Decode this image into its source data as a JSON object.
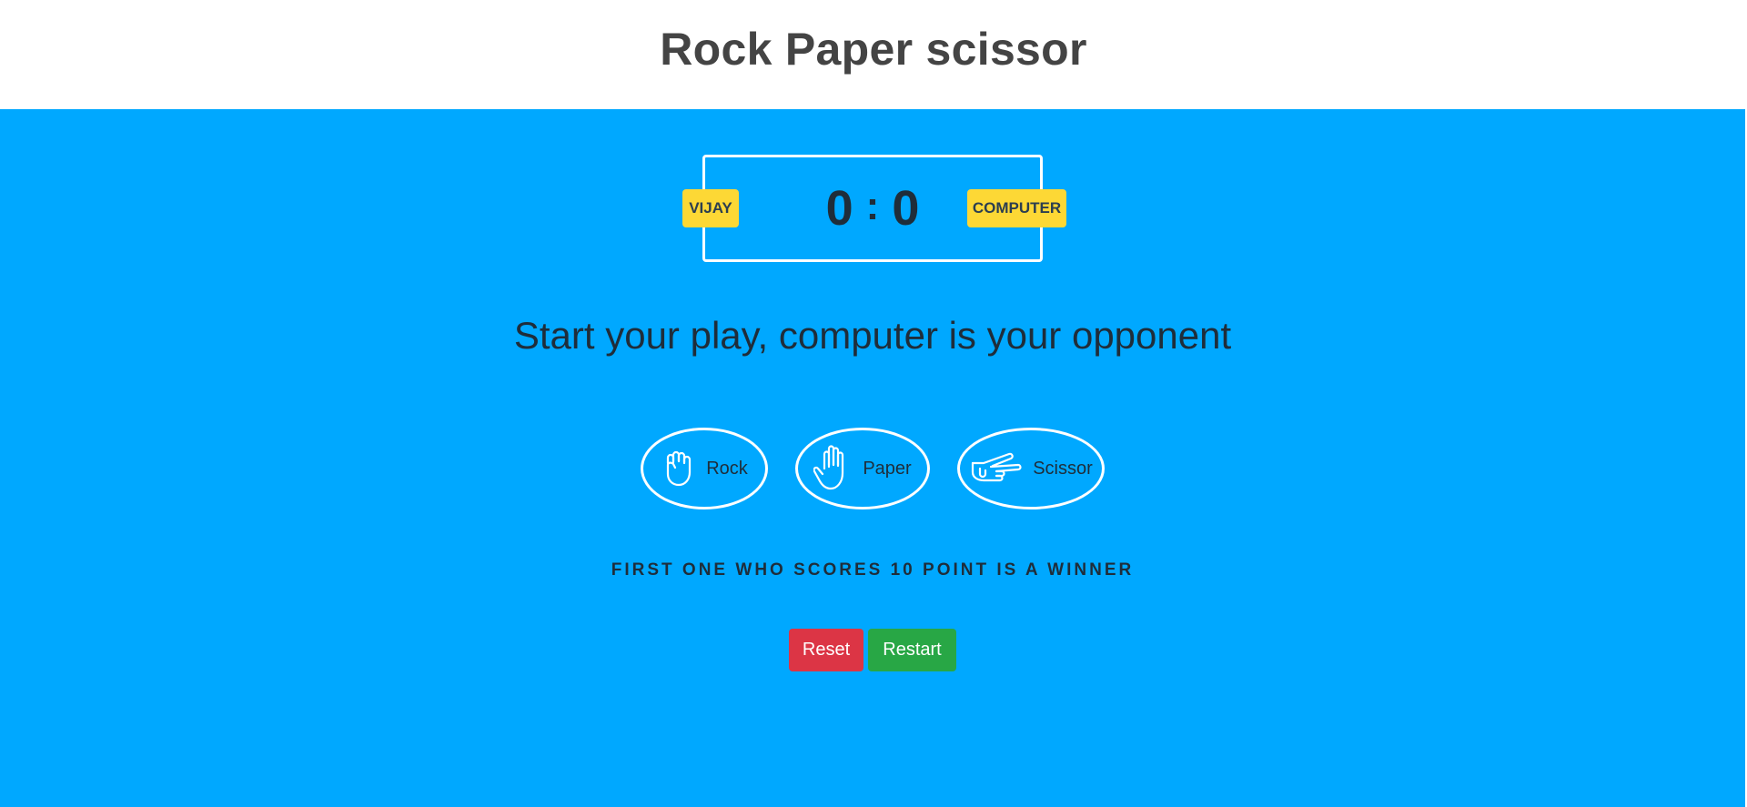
{
  "header": {
    "title": "Rock Paper scissor"
  },
  "scoreboard": {
    "user_label": "VIJAY",
    "computer_label": "COMPUTER",
    "user_score": "0",
    "separator": ":",
    "computer_score": "0"
  },
  "message": "Start your play, computer is your opponent",
  "choices": [
    {
      "label": "Rock",
      "icon": "fist-icon"
    },
    {
      "label": "Paper",
      "icon": "open-hand-icon"
    },
    {
      "label": "Scissor",
      "icon": "peace-hand-icon"
    }
  ],
  "rule_text": "FIRST ONE WHO SCORES 10 POINT IS A WINNER",
  "buttons": {
    "reset_label": "Reset",
    "restart_label": "Restart"
  },
  "colors": {
    "background": "#00a8ff",
    "badge": "#fdd835",
    "reset": "#dc3545",
    "restart": "#28a745",
    "text": "#1f2d3a"
  }
}
